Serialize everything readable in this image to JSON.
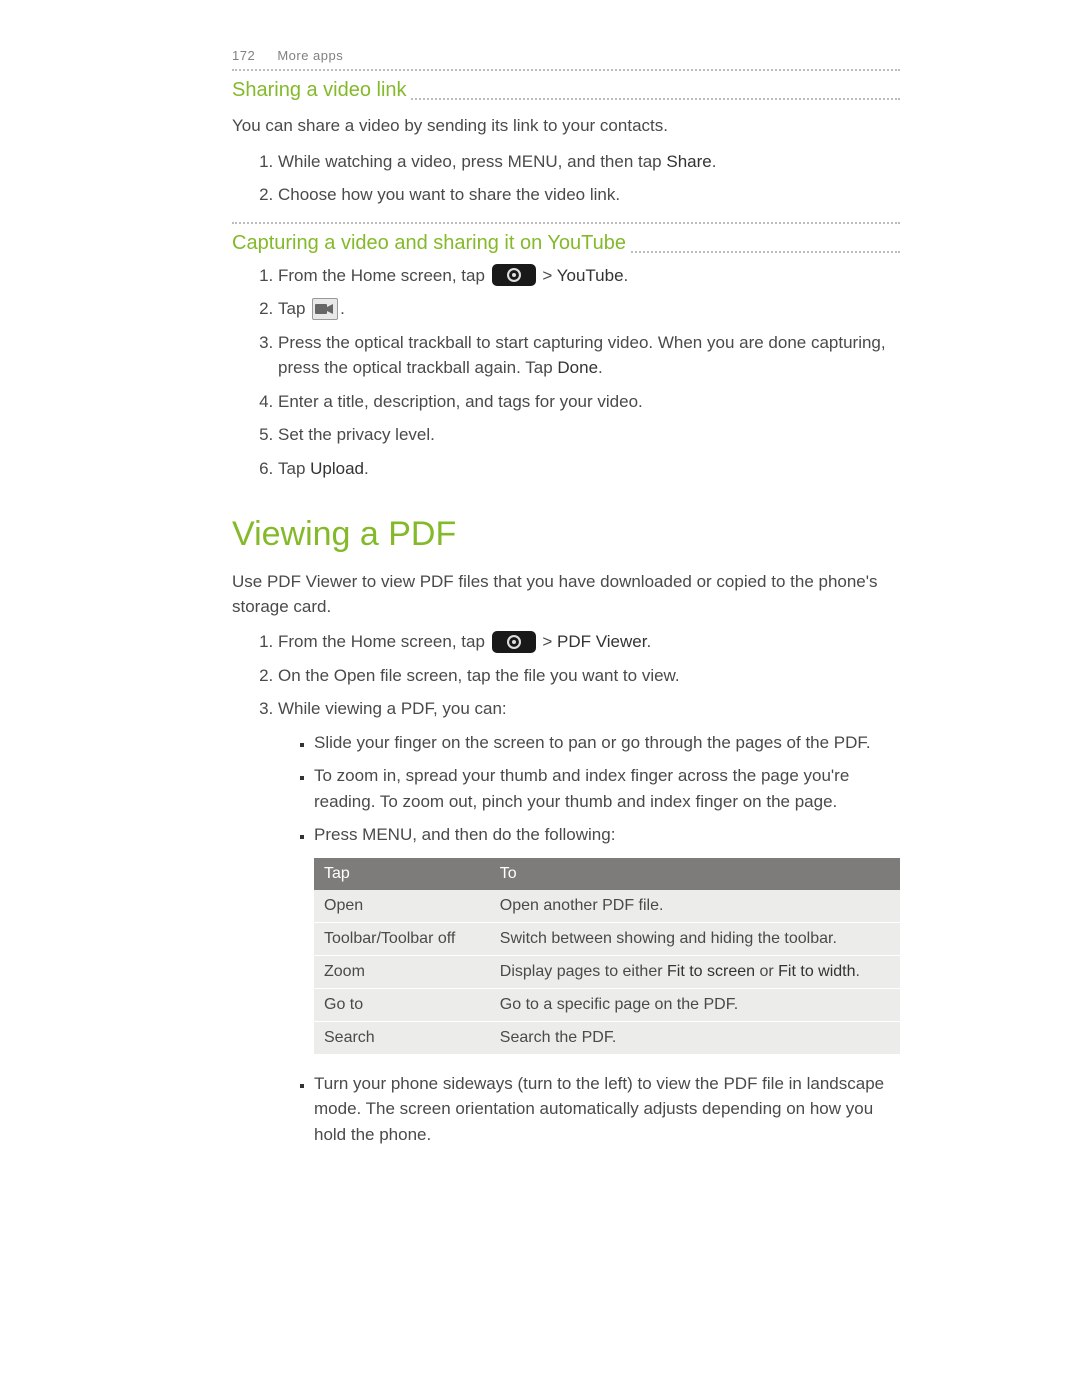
{
  "header": {
    "page_number": "172",
    "chapter": "More apps"
  },
  "section1": {
    "title": "Sharing a video link",
    "intro": "You can share a video by sending its link to your contacts.",
    "steps": {
      "s1a": "While watching a video, press MENU, and then tap ",
      "s1b": "Share",
      "s1c": ".",
      "s2": "Choose how you want to share the video link."
    }
  },
  "section2": {
    "title": "Capturing a video and sharing it on YouTube",
    "steps": {
      "s1a": "From the Home screen, tap ",
      "s1b": " > ",
      "s1c": "YouTube",
      "s1d": ".",
      "s2a": "Tap ",
      "s2b": ".",
      "s3a": "Press the optical trackball to start capturing video. When you are done capturing, press the optical trackball again. Tap ",
      "s3b": "Done",
      "s3c": ".",
      "s4": "Enter a title, description, and tags for your video.",
      "s5": "Set the privacy level.",
      "s6a": "Tap ",
      "s6b": "Upload",
      "s6c": "."
    }
  },
  "section3": {
    "title": "Viewing a PDF",
    "intro": "Use PDF Viewer to view PDF files that you have downloaded or copied to the phone's storage card.",
    "steps": {
      "s1a": "From the Home screen, tap ",
      "s1b": " > ",
      "s1c": "PDF Viewer",
      "s1d": ".",
      "s2": "On the Open file screen, tap the file you want to view.",
      "s3": "While viewing a PDF, you can:"
    },
    "bullets": {
      "b1": "Slide your finger on the screen to pan or go through the pages of the PDF.",
      "b2": "To zoom in, spread your thumb and index finger across the page you're reading. To zoom out, pinch your thumb and index finger on the page.",
      "b3": "Press MENU, and then do the following:",
      "b4": "Turn your phone sideways (turn to the left) to view the PDF file in landscape mode. The screen orientation automatically adjusts depending on how you hold the phone."
    },
    "table": {
      "head_tap": "Tap",
      "head_to": "To",
      "rows": [
        {
          "tap": "Open",
          "to_a": "Open another PDF file.",
          "to_b": "",
          "to_c": "",
          "to_d": "",
          "to_e": ""
        },
        {
          "tap": "Toolbar/Toolbar off",
          "to_a": "Switch between showing and hiding the toolbar.",
          "to_b": "",
          "to_c": "",
          "to_d": "",
          "to_e": ""
        },
        {
          "tap": "Zoom",
          "to_a": "Display pages to either ",
          "to_b": "Fit to screen",
          "to_c": " or ",
          "to_d": "Fit to width",
          "to_e": "."
        },
        {
          "tap": "Go to",
          "to_a": "Go to a specific page on the PDF.",
          "to_b": "",
          "to_c": "",
          "to_d": "",
          "to_e": ""
        },
        {
          "tap": "Search",
          "to_a": "Search the PDF.",
          "to_b": "",
          "to_c": "",
          "to_d": "",
          "to_e": ""
        }
      ]
    }
  }
}
